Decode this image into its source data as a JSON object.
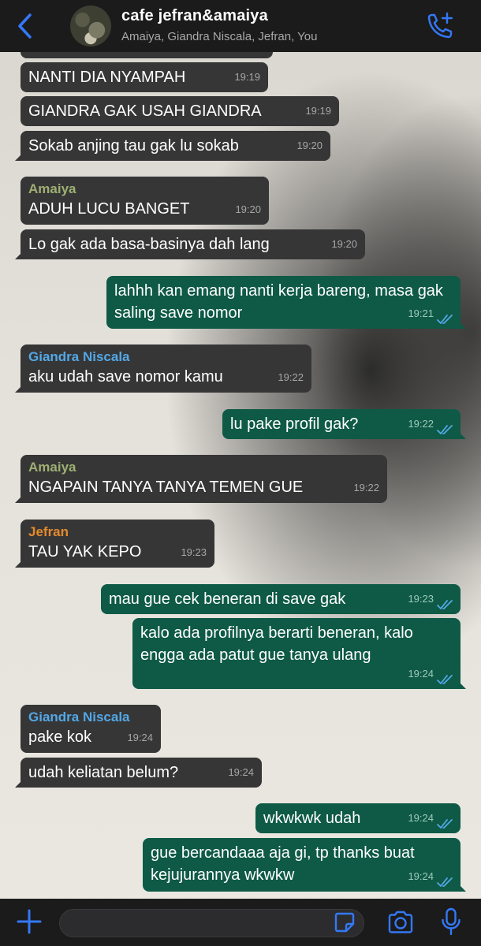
{
  "header": {
    "title": "cafe jefran&amaiya",
    "participants": "Amaiya, Giandra Niscala, Jefran, You",
    "back_icon": "chevron-left-icon",
    "call_icon": "phone-add-icon",
    "accent": "#3478f6"
  },
  "colors": {
    "incoming_bubble": "#363637",
    "outgoing_bubble": "#0e5a46",
    "amaiya": "#9eb071",
    "giandra": "#53a8e6",
    "jefran": "#e58a2d",
    "read_ticks": "#53a8e6"
  },
  "messages": [
    {
      "text": "NANTI DIA NYAMPAH",
      "time": "19:19"
    },
    {
      "text": "GIANDRA GAK USAH GIANDRA",
      "time": "19:19"
    },
    {
      "text": "Sokab anjing tau gak lu sokab",
      "time": "19:20"
    },
    {
      "sender": "Amaiya",
      "text": "ADUH LUCU BANGET",
      "time": "19:20"
    },
    {
      "text": "Lo gak ada basa-basinya dah lang",
      "time": "19:20"
    },
    {
      "text": "lahhh kan emang nanti kerja bareng, masa gak saling save nomor",
      "time": "19:21"
    },
    {
      "sender": "Giandra Niscala",
      "text": "aku udah save nomor kamu",
      "time": "19:22"
    },
    {
      "text": "lu pake profil gak?",
      "time": "19:22"
    },
    {
      "sender": "Amaiya",
      "text": "NGAPAIN TANYA TANYA TEMEN GUE",
      "time": "19:22"
    },
    {
      "sender": "Jefran",
      "text": "TAU YAK KEPO",
      "time": "19:23"
    },
    {
      "text": "mau gue cek beneran di save gak",
      "time": "19:23"
    },
    {
      "text": "kalo ada profilnya berarti beneran, kalo engga ada patut gue tanya ulang",
      "time": "19:24"
    },
    {
      "sender": "Giandra Niscala",
      "text": "pake kok",
      "time": "19:24"
    },
    {
      "text": "udah keliatan belum?",
      "time": "19:24"
    },
    {
      "text": "wkwkwk udah",
      "time": "19:24"
    },
    {
      "text": "gue bercandaaa aja gi, tp thanks buat kejujurannya wkwkw",
      "time": "19:24"
    }
  ],
  "input_bar": {
    "plus_icon": "plus-icon",
    "message_placeholder": "",
    "sticker_icon": "sticker-icon",
    "camera_icon": "camera-icon",
    "mic_icon": "microphone-icon"
  }
}
